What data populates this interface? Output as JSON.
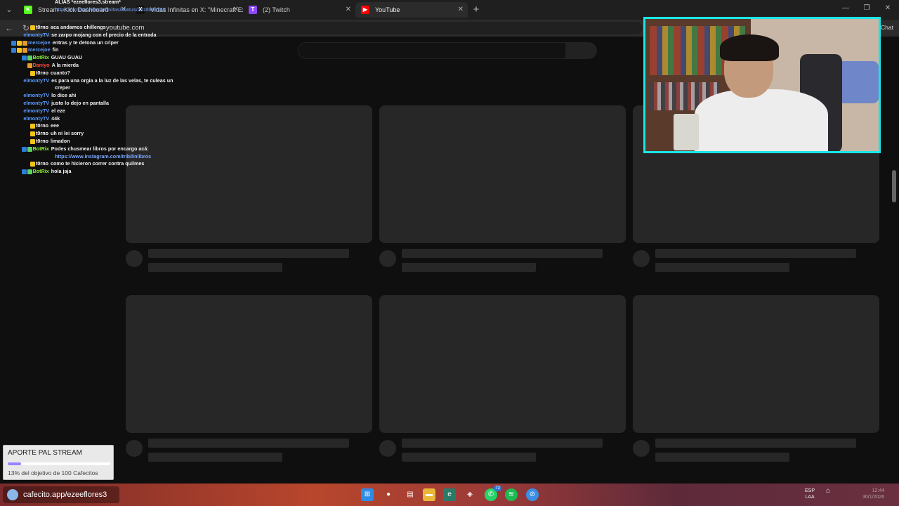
{
  "browser": {
    "tabs": [
      {
        "label": "Stream - Kick Dashboard",
        "favicon": "K",
        "color": "#53fc18",
        "active": false
      },
      {
        "label": "Vidas Infinitas en X: \"Minecraft Ex",
        "favicon": "X",
        "color": "#111111",
        "active": false
      },
      {
        "label": "(2) Twitch",
        "favicon": "T",
        "color": "#9146ff",
        "active": false
      },
      {
        "label": "YouTube",
        "favicon": "▶",
        "color": "#ff0000",
        "active": true
      }
    ],
    "url": "youtube.com",
    "chat_button": "Chat"
  },
  "chat": {
    "header_lines": [
      "ALIAS *ezeeflores3.stream*",
      "https://x.com/vidasinfinitas/status/2018859765"
    ],
    "messages": [
      {
        "user": "t0rno",
        "color": "#ffffff",
        "badges": [
          "check"
        ],
        "text": "aca andamos chillengs"
      },
      {
        "user": "elmontyTV",
        "color": "#5a9cff",
        "badges": [],
        "text": "se zarpo mojang con el precio de la entrada"
      },
      {
        "user": "mercejoe",
        "color": "#5a9cff",
        "badges": [
          "mod",
          "check",
          "sub"
        ],
        "text": "entras y te detona un criper"
      },
      {
        "user": "mercejoe",
        "color": "#5a9cff",
        "badges": [
          "mod",
          "check",
          "sub"
        ],
        "text": "fin"
      },
      {
        "user": "BotRix",
        "color": "#8af03a",
        "badges": [
          "mod",
          "bot"
        ],
        "text": "GUAU GUAU"
      },
      {
        "user": "Daniyo",
        "color": "#ff4a3a",
        "badges": [
          "sub"
        ],
        "text": "A la mierda"
      },
      {
        "user": "t0rno",
        "color": "#ffffff",
        "badges": [
          "check"
        ],
        "text": "cuanto?"
      },
      {
        "user": "elmontyTV",
        "color": "#5a9cff",
        "badges": [],
        "text": "es para una orgia a la luz de las velas, te culeas un"
      },
      {
        "user": "",
        "color": "#ffffff",
        "badges": [],
        "text": "creper"
      },
      {
        "user": "elmontyTV",
        "color": "#5a9cff",
        "badges": [],
        "text": "lo dice ahi"
      },
      {
        "user": "elmontyTV",
        "color": "#5a9cff",
        "badges": [],
        "text": "justo lo dejo en pantalla"
      },
      {
        "user": "elmontyTV",
        "color": "#5a9cff",
        "badges": [],
        "text": "el eze"
      },
      {
        "user": "elmontyTV",
        "color": "#5a9cff",
        "badges": [],
        "text": "44k"
      },
      {
        "user": "t0rno",
        "color": "#ffffff",
        "badges": [
          "check"
        ],
        "text": "eee"
      },
      {
        "user": "t0rno",
        "color": "#ffffff",
        "badges": [
          "check"
        ],
        "text": "uh ni lei sorry"
      },
      {
        "user": "t0rno",
        "color": "#ffffff",
        "badges": [
          "check"
        ],
        "text": "limadon"
      },
      {
        "user": "BotRix",
        "color": "#8af03a",
        "badges": [
          "mod",
          "bot"
        ],
        "text": "Podes chusmear libros por encargo acá:"
      },
      {
        "user": "",
        "color": "#ffffff",
        "badges": [],
        "text": "https://www.instagram.com/tribilinlibros",
        "link": true
      },
      {
        "user": "t0rno",
        "color": "#ffffff",
        "badges": [
          "check"
        ],
        "text": "como te hicieron correr contra quilmes"
      },
      {
        "user": "BotRix",
        "color": "#8af03a",
        "badges": [
          "mod",
          "bot"
        ],
        "text": "hola jaja"
      }
    ]
  },
  "donation": {
    "title": "APORTE PAL STREAM",
    "progress": 0.13,
    "status": "13% del objetivo de 100 Cafecitos"
  },
  "taskbar": {
    "cafecito_label": "cafecito.app/ezeeflores3",
    "whatsapp_badge": "72",
    "lang_top": "ESP",
    "lang_bottom": "LAA",
    "time": "12:44",
    "date": "30/1/2026"
  },
  "colors": {
    "cam_border": "#19e6e6",
    "donate_fill": "#9b82ff"
  }
}
